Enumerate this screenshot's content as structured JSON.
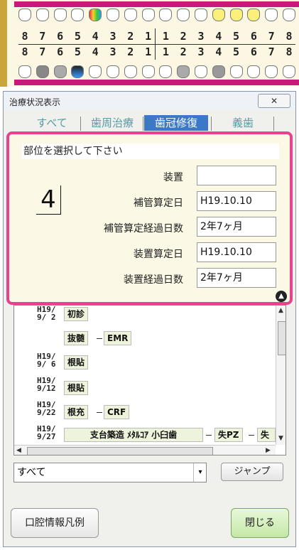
{
  "dental_chart": {
    "upper_numbers": [
      "8",
      "7",
      "6",
      "5",
      "4",
      "3",
      "2",
      "1",
      "1",
      "2",
      "3",
      "4",
      "5",
      "6",
      "7",
      "8"
    ],
    "lower_numbers": [
      "8",
      "7",
      "6",
      "5",
      "4",
      "3",
      "2",
      "1",
      "1",
      "2",
      "3",
      "4",
      "5",
      "6",
      "7",
      "8"
    ]
  },
  "window": {
    "title": "治療状況表示",
    "close_glyph": "✕"
  },
  "tabs": [
    {
      "label": "すべて",
      "active": false
    },
    {
      "label": "歯周治療",
      "active": false
    },
    {
      "label": "歯冠修復",
      "active": true
    },
    {
      "label": "義歯",
      "active": false
    }
  ],
  "panel": {
    "prompt": "部位を選択して下さい",
    "tooth_number": "4",
    "fields": [
      {
        "label": "装置",
        "value": ""
      },
      {
        "label": "補管算定日",
        "value": "H19.10.10"
      },
      {
        "label": "補管算定経過日数",
        "value": "2年7ヶ月"
      },
      {
        "label": "装置算定日",
        "value": "H19.10.10"
      },
      {
        "label": "装置経過日数",
        "value": "2年7ヶ月"
      }
    ]
  },
  "history": {
    "entries": [
      {
        "date_line1": "H19/",
        "date_line2": "9/ 2",
        "items": [
          "初診"
        ]
      },
      {
        "date_line1": "",
        "date_line2": "",
        "items": [
          "抜髄",
          "EMR"
        ]
      },
      {
        "date_line1": "H19/",
        "date_line2": "9/ 6",
        "items": [
          "根貼"
        ]
      },
      {
        "date_line1": "H19/",
        "date_line2": "9/12",
        "items": [
          "根貼"
        ]
      },
      {
        "date_line1": "H19/",
        "date_line2": "9/22",
        "items": [
          "根充",
          "CRF"
        ]
      },
      {
        "date_line1": "H19/",
        "date_line2": "9/27",
        "items": [
          "支台築造 ﾒﾀﾙｺｱ 小臼歯",
          "失PZ",
          "失"
        ]
      }
    ]
  },
  "filter": {
    "selected": "すべて",
    "arrow": "▾"
  },
  "buttons": {
    "jump": "ジャンプ",
    "legend": "口腔情報凡例",
    "close": "閉じる"
  },
  "icons": {
    "scroll_up": "▲",
    "scroll_down": "▼",
    "scroll_left": "◀",
    "scroll_right": "▶",
    "panel_up": "▲"
  }
}
